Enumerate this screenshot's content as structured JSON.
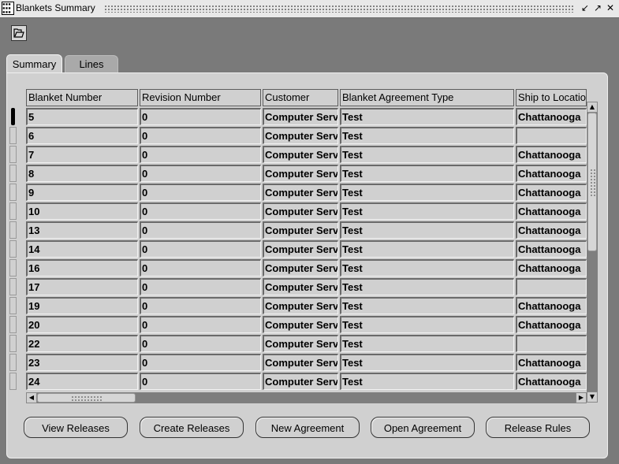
{
  "window": {
    "title": "Blankets Summary",
    "controls": [
      "↙",
      "↗",
      "✕"
    ]
  },
  "tabs": [
    {
      "label": "Summary",
      "active": true
    },
    {
      "label": "Lines",
      "active": false
    }
  ],
  "table": {
    "columns": [
      "Blanket Number",
      "Revision Number",
      "Customer",
      "Blanket Agreement Type",
      "Ship to Locatio"
    ],
    "rows": [
      [
        "5",
        "0",
        "Computer Serv",
        "Test",
        "Chattanooga"
      ],
      [
        "6",
        "0",
        "Computer Serv",
        "Test",
        ""
      ],
      [
        "7",
        "0",
        "Computer Serv",
        "Test",
        "Chattanooga"
      ],
      [
        "8",
        "0",
        "Computer Serv",
        "Test",
        "Chattanooga"
      ],
      [
        "9",
        "0",
        "Computer Serv",
        "Test",
        "Chattanooga"
      ],
      [
        "10",
        "0",
        "Computer Serv",
        "Test",
        "Chattanooga"
      ],
      [
        "13",
        "0",
        "Computer Serv",
        "Test",
        "Chattanooga"
      ],
      [
        "14",
        "0",
        "Computer Serv",
        "Test",
        "Chattanooga"
      ],
      [
        "16",
        "0",
        "Computer Serv",
        "Test",
        "Chattanooga"
      ],
      [
        "17",
        "0",
        "Computer Serv",
        "Test",
        ""
      ],
      [
        "19",
        "0",
        "Computer Serv",
        "Test",
        "Chattanooga"
      ],
      [
        "20",
        "0",
        "Computer Serv",
        "Test",
        "Chattanooga"
      ],
      [
        "22",
        "0",
        "Computer Serv",
        "Test",
        ""
      ],
      [
        "23",
        "0",
        "Computer Serv",
        "Test",
        "Chattanooga"
      ],
      [
        "24",
        "0",
        "Computer Serv",
        "Test",
        "Chattanooga"
      ]
    ]
  },
  "buttons": {
    "view_releases": "View Releases",
    "create_releases": "Create Releases",
    "new_agreement": "New Agreement",
    "open_agreement": "Open Agreement",
    "release_rules": "Release Rules"
  },
  "icons": {
    "toolbar": "folder-open-icon"
  }
}
